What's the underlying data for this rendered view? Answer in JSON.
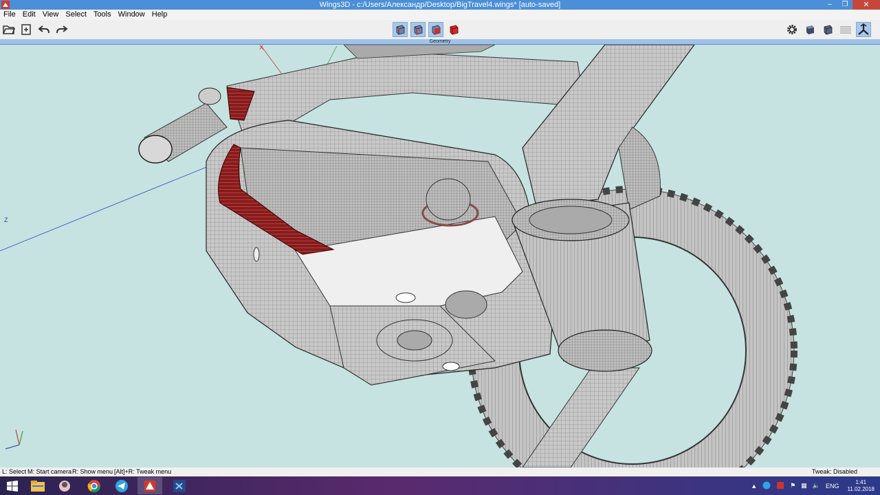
{
  "window": {
    "title": "Wings3D - c:/Users/Александр/Desktop/BigTravel4.wings* [auto-saved]",
    "minimize_glyph": "–",
    "restore_glyph": "❐",
    "close_glyph": "✕"
  },
  "menubar": {
    "items": [
      "File",
      "Edit",
      "View",
      "Select",
      "Tools",
      "Window",
      "Help"
    ]
  },
  "toolbar": {
    "left_icons": [
      "open-folder-icon",
      "save-icon",
      "undo-icon",
      "redo-icon"
    ],
    "selection_modes": [
      "vertex-mode-icon",
      "edge-mode-icon",
      "face-mode-icon",
      "object-mode-icon"
    ],
    "right_icons": [
      "gear-icon",
      "smooth-shaded-icon",
      "flat-shaded-icon",
      "wireframe-icon",
      "perspective-icon"
    ],
    "geometry_label": "Geometry"
  },
  "viewport": {
    "axis_x_label": "X",
    "axis_z_label": "Z",
    "background_color": "#c6e3e1",
    "selection_color": "#8c1a1a",
    "model_color": "#bfbfbf"
  },
  "statusbar": {
    "left_hint_1": "L: Select",
    "left_hint_2": "M: Start camera",
    "left_hint_3": "R: Show menu",
    "left_hint_4": "[Alt]+R: Tweak menu",
    "tweak_status": "Tweak: Disabled"
  },
  "taskbar": {
    "apps": [
      "windows-start-icon",
      "file-explorer-icon",
      "app-icon",
      "chrome-icon",
      "telegram-icon",
      "wings3d-icon",
      "visual-studio-icon"
    ],
    "language": "ENG",
    "time": "1:41",
    "date": "11.02.2018"
  }
}
